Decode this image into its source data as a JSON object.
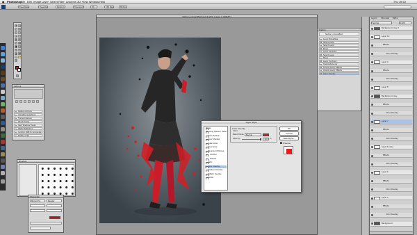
{
  "menubar": {
    "items": [
      "Photoshop",
      "File",
      "Edit",
      "Image",
      "Layer",
      "Select",
      "Filter",
      "Analysis",
      "3D",
      "View",
      "Window",
      "Help"
    ],
    "right": "Thu 16:02"
  },
  "optionsbar": {
    "buttons": [
      "Essentials",
      "Essentials",
      "Painting",
      "Typography",
      "3D",
      "CS5 New",
      "Motion"
    ]
  },
  "document": {
    "title": "fashion_coloureffect.psd @ 25% (Layer 7, RGB/8*)"
  },
  "styles_panel": {
    "title": "Actions",
    "rows": [
      "Default Actions",
      "Vignette (selection)",
      "Frame Channel",
      "Wood Frame",
      "Cast Shadow (type)",
      "Water Reflection",
      "Custom RGB to Grayscale",
      "Molten Lead"
    ]
  },
  "swatches_panel": {
    "title": "Brushes"
  },
  "character_panel": {
    "title": "Character",
    "font_style": "Regular",
    "font_name": "Myriad Pro"
  },
  "history_panel": {
    "title": "History",
    "items": [
      "fashion_coloureffect",
      "Layer Properties",
      "Select Layer",
      "Select Layer",
      "Move",
      "Layer Via Copy",
      "Select Layer",
      "Move",
      "Layer Via Copy",
      "Duplicate Layer",
      "Double Layer Effects",
      "Double Layer Effects",
      "Color Overlay"
    ]
  },
  "layer_style_dialog": {
    "title": "Layer Style",
    "styles": [
      "Styles",
      "Blending Options: Default",
      "Drop Shadow",
      "Inner Shadow",
      "Outer Glow",
      "Inner Glow",
      "Bevel and Emboss",
      "Contour",
      "Texture",
      "Satin",
      "Color Overlay",
      "Gradient Overlay",
      "Pattern Overlay",
      "Stroke"
    ],
    "section": "Color Overlay",
    "subsection": "Color",
    "blend_label": "Blend Mode:",
    "blend_mode": "Normal",
    "opacity_label": "Opacity:",
    "opacity_value": "100",
    "opacity_unit": "%",
    "buttons": {
      "ok": "OK",
      "cancel": "Cancel",
      "new_style": "New Style...",
      "preview": "Preview"
    },
    "overlay_color": "#e01e1e"
  },
  "layers_panel": {
    "tabs": [
      "Layers",
      "Channels",
      "Paths"
    ],
    "blend": "Normal",
    "opacity": "100%",
    "rows": [
      "Background copy 2",
      "Layer 10",
      "Effects",
      "Color Overlay",
      "Layer 9",
      "Effects",
      "Color Overlay",
      "Layer 8",
      "Background copy",
      "Effects",
      "Color Overlay",
      "Layer 7",
      "Effects",
      "Color Overlay",
      "Layer 6 copy",
      "Effects",
      "Color Overlay",
      "Layer 6",
      "Effects",
      "Color Overlay",
      "Layer 5",
      "Effects",
      "Color Overlay",
      "Background"
    ],
    "selected_index": 11
  },
  "colors": {
    "accent_red": "#e01e1e",
    "selection_blue": "#aac4e6"
  }
}
